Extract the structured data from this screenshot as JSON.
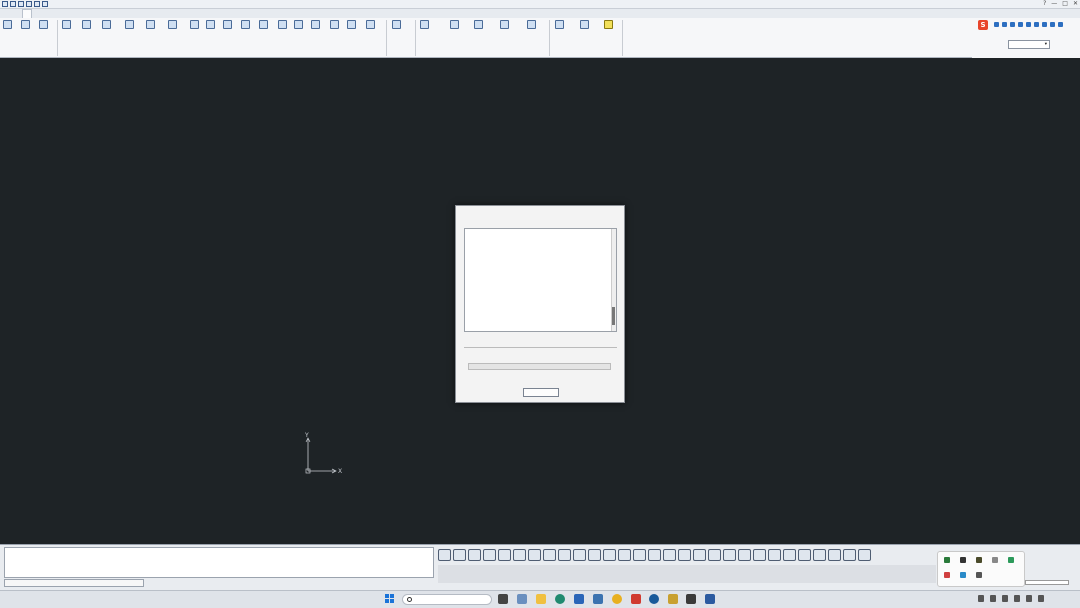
{
  "window": {
    "title": "",
    "controls": [
      "?",
      "—",
      "□",
      "✕"
    ]
  },
  "tabs": [
    {
      "label": "",
      "active": false
    },
    {
      "label": "",
      "active": false
    },
    {
      "label": "",
      "active": true
    },
    {
      "label": "",
      "active": false
    },
    {
      "label": "",
      "active": false
    },
    {
      "label": "",
      "active": false
    },
    {
      "label": "",
      "active": false
    },
    {
      "label": "",
      "active": false
    },
    {
      "label": "",
      "active": false
    },
    {
      "label": "",
      "active": false
    },
    {
      "label": "",
      "active": false
    },
    {
      "label": "",
      "active": false
    },
    {
      "label": "",
      "active": false
    },
    {
      "label": "",
      "active": false
    },
    {
      "label": "",
      "active": false
    },
    {
      "label": "",
      "active": false
    }
  ],
  "ribbon": {
    "tools": [
      {
        "label": ""
      },
      {
        "label": ""
      },
      {
        "label": ""
      },
      {
        "label": ""
      },
      {
        "label": ""
      },
      {
        "label": ""
      },
      {
        "label": ""
      },
      {
        "label": ""
      },
      {
        "label": ""
      },
      {
        "label": ""
      },
      {
        "label": ""
      },
      {
        "label": ""
      },
      {
        "label": ""
      },
      {
        "label": ""
      },
      {
        "label": ""
      },
      {
        "label": ""
      },
      {
        "label": ""
      },
      {
        "label": ""
      },
      {
        "label": ""
      },
      {
        "label": ""
      },
      {
        "label": ""
      },
      {
        "label": ""
      },
      {
        "label": ""
      },
      {
        "label": ""
      },
      {
        "label": ""
      },
      {
        "label": ""
      },
      {
        "label": ""
      },
      {
        "label": ""
      },
      {
        "label": ""
      },
      {
        "label": ""
      },
      {
        "label": ""
      }
    ],
    "groups": [
      {
        "label": ""
      },
      {
        "label": ""
      },
      {
        "label": ""
      },
      {
        "label": ""
      },
      {
        "label": ""
      },
      {
        "label": ""
      },
      {
        "label": ""
      },
      {
        "label": ""
      }
    ],
    "floor_select": ""
  },
  "dialog": {
    "title": "",
    "log_heading": "",
    "log_lines": [
      "",
      "",
      "",
      "",
      "",
      "",
      "",
      "",
      "",
      "",
      "",
      "",
      "",
      "",
      "",
      "",
      "",
      "",
      "",
      "",
      "",
      ""
    ],
    "progress_heading": "",
    "analysis_stage_label": "",
    "analysis_stage_value": "",
    "progress_fraction": 0.0,
    "elapsed_label": "",
    "elapsed_value": "",
    "stop_button": ""
  },
  "canvas": {
    "axis_y": "Y",
    "axis_x": "X"
  },
  "command": {
    "lines": [
      "",
      "",
      "",
      ""
    ],
    "coordinates": ""
  },
  "taskbar": {
    "weather_temp": "",
    "weather_desc": "",
    "search_placeholder": "",
    "time": "",
    "date": ""
  }
}
